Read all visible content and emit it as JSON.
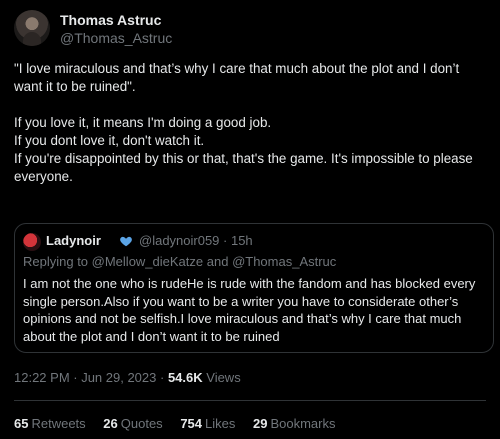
{
  "author": {
    "name": "Thomas Astruc",
    "handle": "@Thomas_Astruc"
  },
  "tweet": {
    "text": "\"I love miraculous and that’s why I care that much about the plot and I don’t want it to be ruined\".\n\nIf you love it, it means I'm doing a good job.\nIf you dont love it, don't watch it.\nIf you're disappointed  by this or that, that's the game. It's impossible to please everyone."
  },
  "quote": {
    "name": "Ladynoir",
    "handle_time": "@ladynoir059 · 15h",
    "replying_prefix": "Replying to ",
    "mention1": "@Mellow_dieKatze",
    "and": " and ",
    "mention2": "@Thomas_Astruc",
    "text": "I am not the one who is rudeHe is rude with the fandom and has blocked every single person.Also if you want to be a writer you have to considerate other’s opinions and not be selfish.I love miraculous and that’s why I care that much about the plot and I don’t want it to be ruined"
  },
  "meta": {
    "time": "12:22 PM · Jun 29, 2023 · ",
    "views_count": "54.6K",
    "views_label": " Views"
  },
  "stats": {
    "retweets_count": "65",
    "retweets_label": "Retweets",
    "quotes_count": "26",
    "quotes_label": "Quotes",
    "likes_count": "754",
    "likes_label": "Likes",
    "bookmarks_count": "29",
    "bookmarks_label": "Bookmarks"
  },
  "colors": {
    "background": "#000000",
    "text": "#e7e9ea",
    "secondary": "#71767b",
    "heart": "#5ba4e6"
  },
  "icons": {
    "more": "more-icon",
    "heart": "blue-heart-icon"
  }
}
